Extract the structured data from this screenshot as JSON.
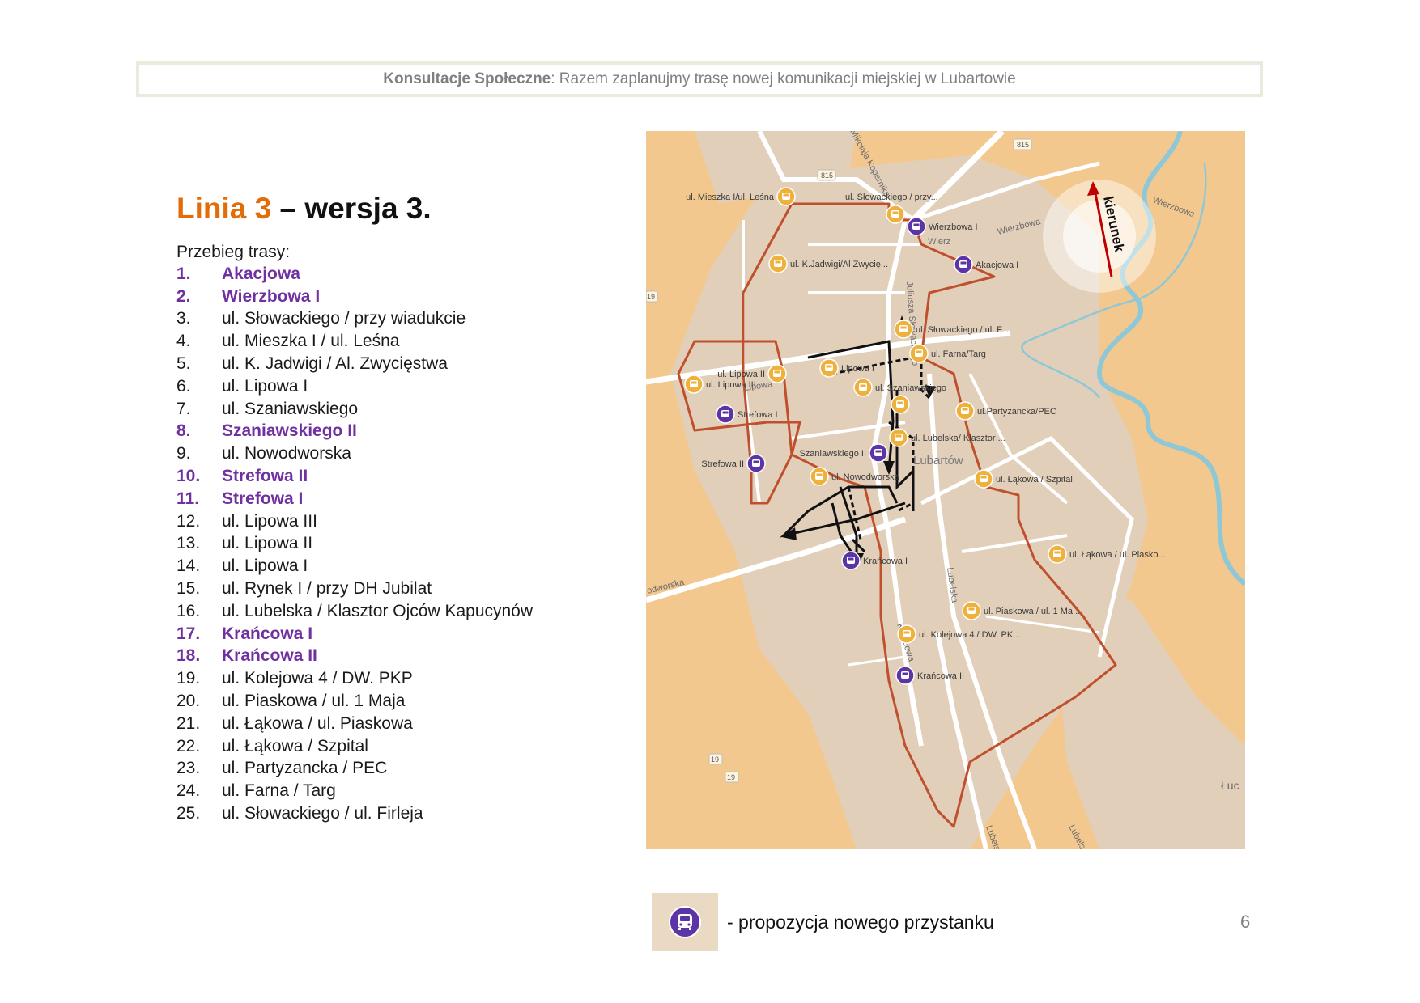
{
  "header": {
    "bold_part": "Konsultacje Społeczne",
    "rest": ": Razem zaplanujmy trasę nowej komunikacji miejskiej w Lubartowie"
  },
  "title": {
    "accent": "Linia 3",
    "rest": " – wersja 3."
  },
  "route_label": "Przebieg trasy:",
  "route": [
    {
      "num": "1.",
      "name": "Akacjowa",
      "new": true
    },
    {
      "num": "2.",
      "name": "Wierzbowa I",
      "new": true
    },
    {
      "num": "3.",
      "name": "ul. Słowackiego / przy wiadukcie",
      "new": false
    },
    {
      "num": "4.",
      "name": "ul. Mieszka I / ul. Leśna",
      "new": false
    },
    {
      "num": "5.",
      "name": "ul. K. Jadwigi / Al. Zwycięstwa",
      "new": false
    },
    {
      "num": "6.",
      "name": "ul. Lipowa I",
      "new": false
    },
    {
      "num": "7.",
      "name": "ul. Szaniawskiego",
      "new": false
    },
    {
      "num": "8.",
      "name": "Szaniawskiego II",
      "new": true
    },
    {
      "num": "9.",
      "name": "ul. Nowodworska",
      "new": false
    },
    {
      "num": "10.",
      "name": "Strefowa II",
      "new": true
    },
    {
      "num": "11.",
      "name": "Strefowa I",
      "new": true
    },
    {
      "num": "12.",
      "name": "ul. Lipowa III",
      "new": false
    },
    {
      "num": "13.",
      "name": "ul. Lipowa II",
      "new": false
    },
    {
      "num": "14.",
      "name": "ul. Lipowa I",
      "new": false
    },
    {
      "num": "15.",
      "name": "ul. Rynek I / przy DH Jubilat",
      "new": false
    },
    {
      "num": "16.",
      "name": "ul. Lubelska / Klasztor Ojców Kapucynów",
      "new": false
    },
    {
      "num": "17.",
      "name": "Krańcowa I",
      "new": true
    },
    {
      "num": "18.",
      "name": "Krańcowa II",
      "new": true
    },
    {
      "num": "19.",
      "name": "ul. Kolejowa 4 / DW. PKP",
      "new": false
    },
    {
      "num": "20.",
      "name": "ul. Piaskowa / ul. 1 Maja",
      "new": false
    },
    {
      "num": "21.",
      "name": "ul. Łąkowa / ul. Piaskowa",
      "new": false
    },
    {
      "num": "22.",
      "name": "ul. Łąkowa / Szpital",
      "new": false
    },
    {
      "num": "23.",
      "name": "ul. Partyzancka / PEC",
      "new": false
    },
    {
      "num": "24.",
      "name": "ul. Farna / Targ",
      "new": false
    },
    {
      "num": "25.",
      "name": "ul. Słowackiego / ul. Firleja",
      "new": false
    }
  ],
  "map": {
    "colors": {
      "land": "#f3c88e",
      "urban": "#e2cfba",
      "road": "#ffffff",
      "route": "#c0502d",
      "water": "#8ec7d6",
      "stop_existing": "#eeb13b",
      "stop_new": "#5b35a5"
    },
    "direction_label": "kierunek",
    "road_labels": [
      {
        "id": "lipowa",
        "text": "Lipowa"
      },
      {
        "id": "lubelska",
        "text": "Lubelska"
      },
      {
        "id": "kopernika",
        "text": "Mikołaja Kopernika"
      },
      {
        "id": "slowackiego",
        "text": "Juliusza Słowackiego"
      },
      {
        "id": "kancowa",
        "text": "Krańcowa"
      },
      {
        "id": "nowodworska",
        "text": "odworska"
      },
      {
        "id": "wierzbowa1",
        "text": "Wierzbowa"
      },
      {
        "id": "wierzbowa2",
        "text": "Wierzbowa"
      },
      {
        "id": "town",
        "text": "Lubartów"
      },
      {
        "id": "luc",
        "text": "Łuc"
      },
      {
        "id": "lubelska2",
        "text": "Lubels"
      },
      {
        "id": "wierz_small",
        "text": "Wierz"
      },
      {
        "id": "lublinska",
        "text": "Lubelska"
      }
    ],
    "road_shields": [
      "815",
      "815",
      "19",
      "19",
      "19"
    ],
    "stops": [
      {
        "id": "mieszka",
        "label": "ul. Mieszka I/ul. Leśna",
        "new": false
      },
      {
        "id": "slow_wiad",
        "label": "ul. Słowackiego / przy...",
        "new": false
      },
      {
        "id": "wierzbowa",
        "label": "Wierzbowa I",
        "new": true
      },
      {
        "id": "jadwigi",
        "label": "ul. K.Jadwigi/Al Zwycię...",
        "new": false
      },
      {
        "id": "akacjowa",
        "label": "Akacjowa I",
        "new": true
      },
      {
        "id": "slow_f",
        "label": "ul. Słowackiego / ul. F...",
        "new": false
      },
      {
        "id": "farna",
        "label": "ul. Farna/Targ",
        "new": false
      },
      {
        "id": "lipowa2",
        "label": "ul. Lipowa II",
        "new": false
      },
      {
        "id": "lipowa3",
        "label": "ul. Lipowa III",
        "new": false
      },
      {
        "id": "lipowa1",
        "label": "Lipowa I",
        "new": false
      },
      {
        "id": "szaniawskiego",
        "label": "ul. Szaniawskiego",
        "new": false
      },
      {
        "id": "strefowa1",
        "label": "Strefowa I",
        "new": true
      },
      {
        "id": "partyzancka",
        "label": "ul.Partyzancka/PEC",
        "new": false
      },
      {
        "id": "rynek",
        "label": "",
        "new": false
      },
      {
        "id": "lubelska_kl",
        "label": "ul. Lubelska/ Klasztor ...",
        "new": false
      },
      {
        "id": "szan2",
        "label": "Szaniawskiego II",
        "new": true
      },
      {
        "id": "strefowa2",
        "label": "Strefowa II",
        "new": true
      },
      {
        "id": "nowodworska",
        "label": "ul. Nowodworska",
        "new": false
      },
      {
        "id": "lakowa_sz",
        "label": "ul. Łąkowa / Szpital",
        "new": false
      },
      {
        "id": "krancowa1",
        "label": "Krańcowa I",
        "new": true
      },
      {
        "id": "lakowa_p",
        "label": "ul. Łąkowa / ul. Piasko...",
        "new": false
      },
      {
        "id": "piaskowa",
        "label": "ul. Piaskowa / ul. 1 Ma...",
        "new": false
      },
      {
        "id": "kolejowa",
        "label": "ul. Kolejowa 4 / DW. PK...",
        "new": false
      },
      {
        "id": "krancowa2",
        "label": "Krańcowa II",
        "new": true
      }
    ]
  },
  "legend": {
    "text": "- propozycja nowego przystanku",
    "icon": "bus-stop-new-icon"
  },
  "page_number": "6"
}
